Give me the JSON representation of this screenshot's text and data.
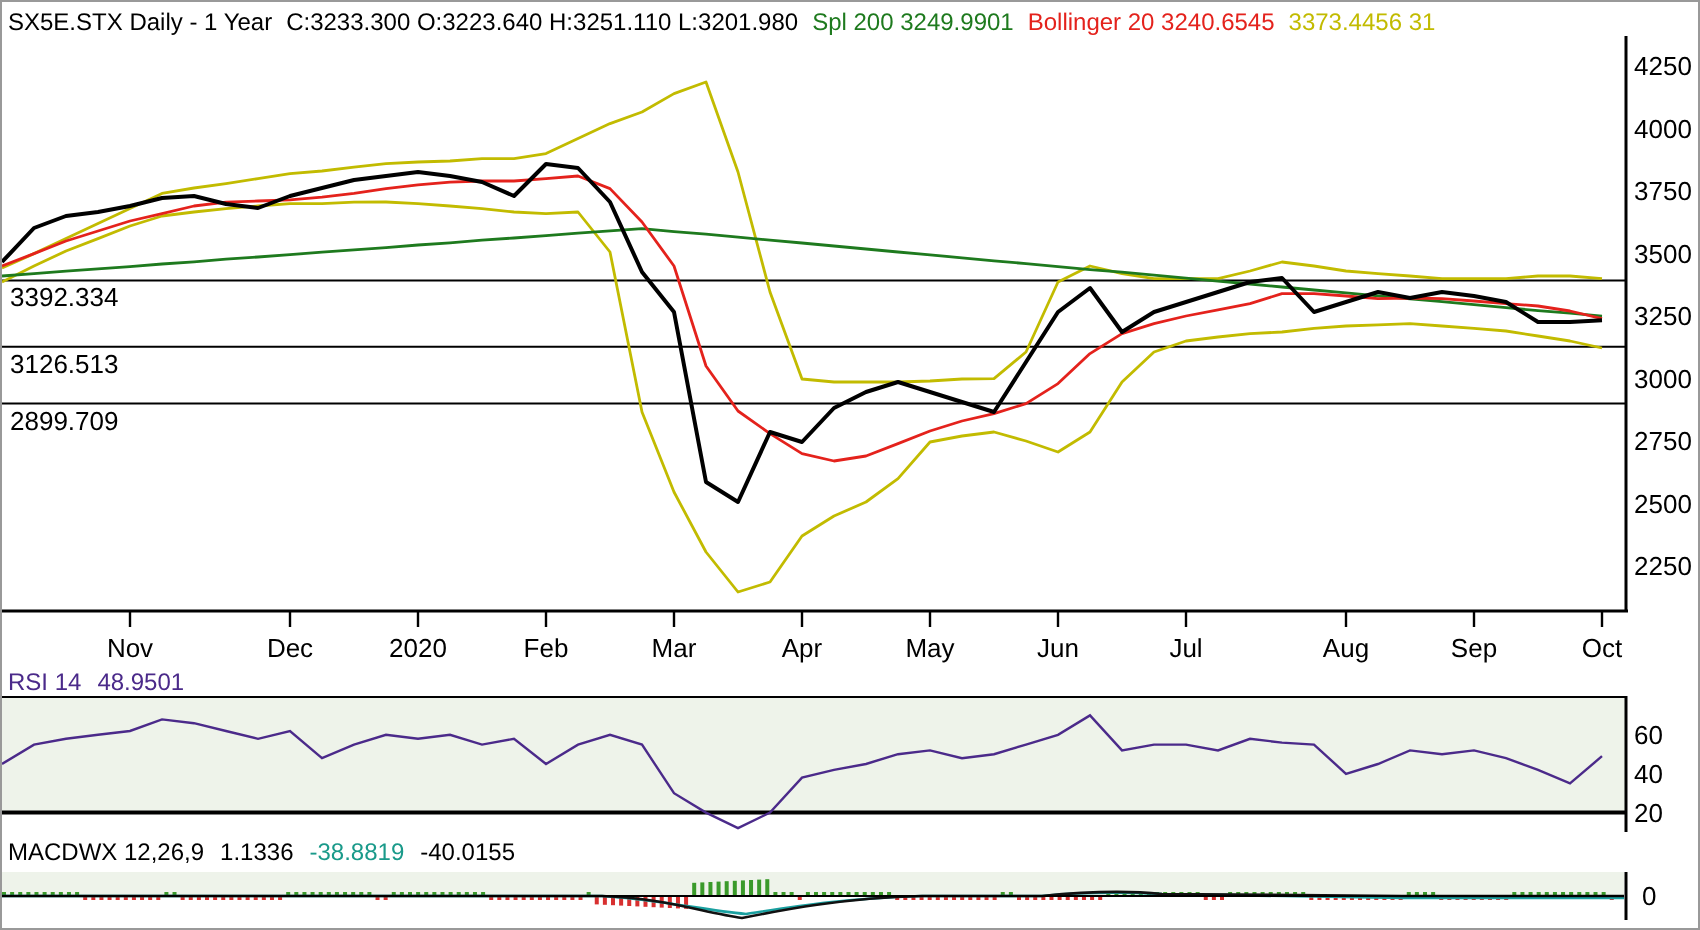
{
  "header": {
    "title": "SX5E.STX Daily -  1 Year",
    "quote": "C:3233.300 O:3223.640 H:3251.110 L:3201.980",
    "legend": [
      {
        "label": "Spl 200 3249.9901",
        "color": "#1e7a1e"
      },
      {
        "label": "Bollinger 20 3240.6545",
        "color": "#e4221c"
      },
      {
        "label": "3373.4456 31",
        "color": "#c2bb00"
      }
    ]
  },
  "price_chart": {
    "chart_data": {
      "type": "line",
      "categories": [
        null,
        null,
        null,
        null,
        "Nov",
        null,
        null,
        null,
        null,
        "Dec",
        null,
        null,
        null,
        "2020",
        null,
        null,
        null,
        "Feb",
        null,
        null,
        null,
        "Mar",
        null,
        null,
        null,
        "Apr",
        null,
        null,
        null,
        "May",
        null,
        null,
        null,
        "Jun",
        null,
        null,
        null,
        "Jul",
        null,
        null,
        null,
        null,
        "Aug",
        null,
        null,
        null,
        "Sep",
        null,
        null,
        null,
        "Oct"
      ],
      "ylim": [
        2070,
        4370
      ],
      "yticks": [
        2250,
        2500,
        2750,
        3000,
        3250,
        3500,
        3750,
        4000,
        4250
      ],
      "series": [
        {
          "color": "#c2bb00",
          "values": [
            3442,
            3500,
            3560,
            3620,
            3680,
            3740,
            3762,
            3780,
            3800,
            3820,
            3830,
            3845,
            3860,
            3866,
            3870,
            3880,
            3880,
            3900,
            3960,
            4020,
            4066,
            4140,
            4186,
            3826,
            3346,
            2998,
            2986,
            2986,
            2986,
            2990,
            2998,
            3000,
            3106,
            3386,
            3450,
            3420,
            3400,
            3400,
            3400,
            3430,
            3466,
            3450,
            3430,
            3420,
            3410,
            3400,
            3400,
            3400,
            3410,
            3410,
            3400
          ]
        },
        {
          "color": "#c2bb00",
          "values": [
            3386,
            3450,
            3510,
            3560,
            3610,
            3650,
            3666,
            3680,
            3690,
            3700,
            3700,
            3705,
            3706,
            3700,
            3690,
            3680,
            3666,
            3660,
            3666,
            3506,
            2866,
            2546,
            2306,
            2146,
            2186,
            2370,
            2450,
            2506,
            2600,
            2746,
            2770,
            2786,
            2750,
            2706,
            2786,
            2986,
            3106,
            3150,
            3166,
            3180,
            3186,
            3200,
            3210,
            3215,
            3220,
            3210,
            3200,
            3190,
            3170,
            3150,
            3122
          ]
        },
        {
          "color": "#1e7a1e",
          "values": [
            3410,
            3420,
            3429,
            3439,
            3448,
            3458,
            3467,
            3477,
            3486,
            3496,
            3505,
            3515,
            3524,
            3534,
            3543,
            3553,
            3562,
            3572,
            3581,
            3591,
            3600,
            3588,
            3577,
            3565,
            3553,
            3542,
            3530,
            3518,
            3506,
            3495,
            3483,
            3471,
            3460,
            3448,
            3436,
            3425,
            3413,
            3401,
            3389,
            3378,
            3366,
            3354,
            3343,
            3331,
            3319,
            3308,
            3296,
            3284,
            3272,
            3261,
            3249
          ]
        },
        {
          "color": "#e4221c",
          "values": [
            3450,
            3500,
            3550,
            3590,
            3630,
            3660,
            3690,
            3705,
            3710,
            3715,
            3725,
            3740,
            3760,
            3775,
            3785,
            3790,
            3790,
            3800,
            3810,
            3760,
            3626,
            3450,
            3050,
            2870,
            2780,
            2700,
            2670,
            2690,
            2740,
            2790,
            2830,
            2860,
            2900,
            2980,
            3100,
            3180,
            3220,
            3250,
            3275,
            3300,
            3340,
            3340,
            3330,
            3320,
            3322,
            3320,
            3310,
            3300,
            3290,
            3270,
            3240
          ]
        },
        {
          "color": "#000000",
          "values": [
            3466,
            3602,
            3650,
            3666,
            3690,
            3722,
            3730,
            3698,
            3682,
            3730,
            3762,
            3794,
            3810,
            3826,
            3810,
            3786,
            3730,
            3858,
            3842,
            3706,
            3426,
            3266,
            2586,
            2506,
            2786,
            2746,
            2882,
            2946,
            2986,
            2946,
            2906,
            2866,
            3066,
            3266,
            3362,
            3186,
            3266,
            3306,
            3346,
            3386,
            3402,
            3266,
            3306,
            3346,
            3322,
            3346,
            3330,
            3306,
            3226,
            3226,
            3233
          ]
        }
      ]
    },
    "level_lines": [
      {
        "label": "3392.334"
      },
      {
        "label": "3126.513"
      },
      {
        "label": "2899.709"
      }
    ]
  },
  "rsi_panel": {
    "title": "RSI 14",
    "value": "48.9501",
    "chart_data": {
      "type": "line",
      "ylim": [
        10,
        80
      ],
      "yticks": [
        20,
        40,
        60
      ],
      "series": [
        {
          "color": "#4b2a8a",
          "values": [
            45,
            55,
            58,
            60,
            62,
            68,
            66,
            62,
            58,
            62,
            48,
            55,
            60,
            58,
            60,
            55,
            58,
            45,
            55,
            60,
            55,
            30,
            20,
            12,
            20,
            38,
            42,
            45,
            50,
            52,
            48,
            50,
            55,
            60,
            70,
            52,
            55,
            55,
            52,
            58,
            56,
            55,
            40,
            45,
            52,
            50,
            52,
            48,
            42,
            35,
            49
          ]
        }
      ]
    }
  },
  "macd_panel": {
    "title": "MACDWX 12,26,9",
    "values": [
      {
        "text": "1.1336",
        "color": "#000000"
      },
      {
        "text": "-38.8819",
        "color": "#1a9a8a"
      },
      {
        "text": "-40.0155",
        "color": "#000000"
      }
    ],
    "zero_label": "0"
  }
}
